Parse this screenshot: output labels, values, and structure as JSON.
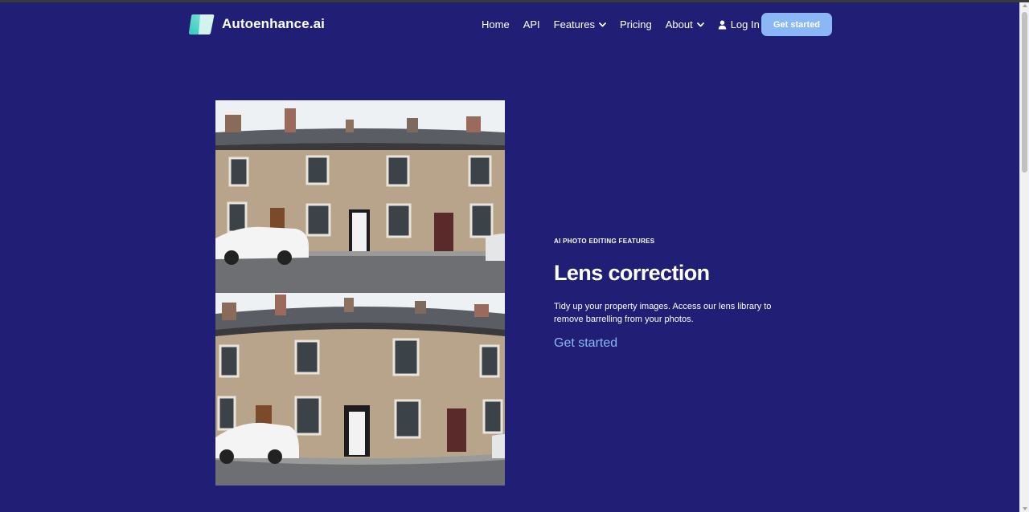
{
  "brand": {
    "name": "Autoenhance.ai",
    "logo_icon": "autoenhance-logo-icon"
  },
  "nav": {
    "items": [
      {
        "label": "Home"
      },
      {
        "label": "API"
      },
      {
        "label": "Features",
        "icon": "chevron-down-icon"
      },
      {
        "label": "Pricing"
      },
      {
        "label": "About",
        "icon": "chevron-down-icon"
      }
    ],
    "login_label": "Log In",
    "login_icon": "user-icon",
    "cta_label": "Get started"
  },
  "feature": {
    "eyebrow": "AI PHOTO EDITING FEATURES",
    "title": "Lens correction",
    "description": "Tidy up your property images. Access our lens library to remove barrelling from your photos.",
    "link_label": "Get started"
  },
  "colors": {
    "background": "#211f75",
    "accent": "#8bb7f7",
    "text": "#ffffff"
  }
}
